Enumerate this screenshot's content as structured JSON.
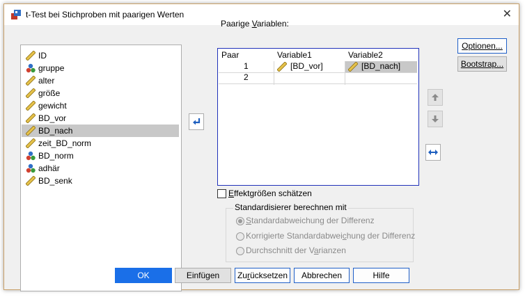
{
  "window": {
    "title": "t-Test bei Stichproben mit paarigen Werten"
  },
  "variables": [
    {
      "name": "ID",
      "icon": "scale-ruler-icon"
    },
    {
      "name": "gruppe",
      "icon": "nominal-balls-icon"
    },
    {
      "name": "alter",
      "icon": "scale-ruler-icon"
    },
    {
      "name": "größe",
      "icon": "scale-ruler-icon"
    },
    {
      "name": "gewicht",
      "icon": "scale-ruler-icon"
    },
    {
      "name": "BD_vor",
      "icon": "scale-ruler-icon"
    },
    {
      "name": "BD_nach",
      "icon": "scale-ruler-icon",
      "selected": true
    },
    {
      "name": "zeit_BD_norm",
      "icon": "scale-ruler-icon"
    },
    {
      "name": "BD_norm",
      "icon": "nominal-balls-icon"
    },
    {
      "name": "adhär",
      "icon": "nominal-balls-icon"
    },
    {
      "name": "BD_senk",
      "icon": "scale-ruler-icon"
    }
  ],
  "pairs_panel": {
    "label_pre": "Paarige ",
    "label_u": "V",
    "label_post": "ariablen:",
    "headers": {
      "pair": "Paar",
      "var1": "Variable1",
      "var2": "Variable2"
    },
    "rows": [
      {
        "pair": "1",
        "var1": "[BD_vor]",
        "var2": "[BD_nach]"
      },
      {
        "pair": "2",
        "var1": "",
        "var2": ""
      }
    ]
  },
  "side_buttons": {
    "options": "Optionen...",
    "bootstrap": "Bootstrap..."
  },
  "effect": {
    "u": "E",
    "rest": "ffektgrößen schätzen",
    "checked": false
  },
  "standardizer": {
    "title": "Standardisierer berechnen mit",
    "options": [
      {
        "pre": "",
        "u": "S",
        "post": "tandardabweichung der Differenz",
        "selected": true
      },
      {
        "pre": "Korrigierte Standardabwei",
        "u": "c",
        "post": "hung der Differenz",
        "selected": false
      },
      {
        "pre": "Durchschnitt der V",
        "u": "a",
        "post": "rianzen",
        "selected": false
      }
    ]
  },
  "footer": {
    "ok": "OK",
    "paste": "Einfügen",
    "reset_pre": "Zu",
    "reset_u": "r",
    "reset_post": "ücksetzen",
    "cancel": "Abbrechen",
    "help": "Hilfe"
  },
  "colors": {
    "accent": "#1a6fe8",
    "selection": "#c8c8c8",
    "panel_border": "#1f30b9"
  }
}
